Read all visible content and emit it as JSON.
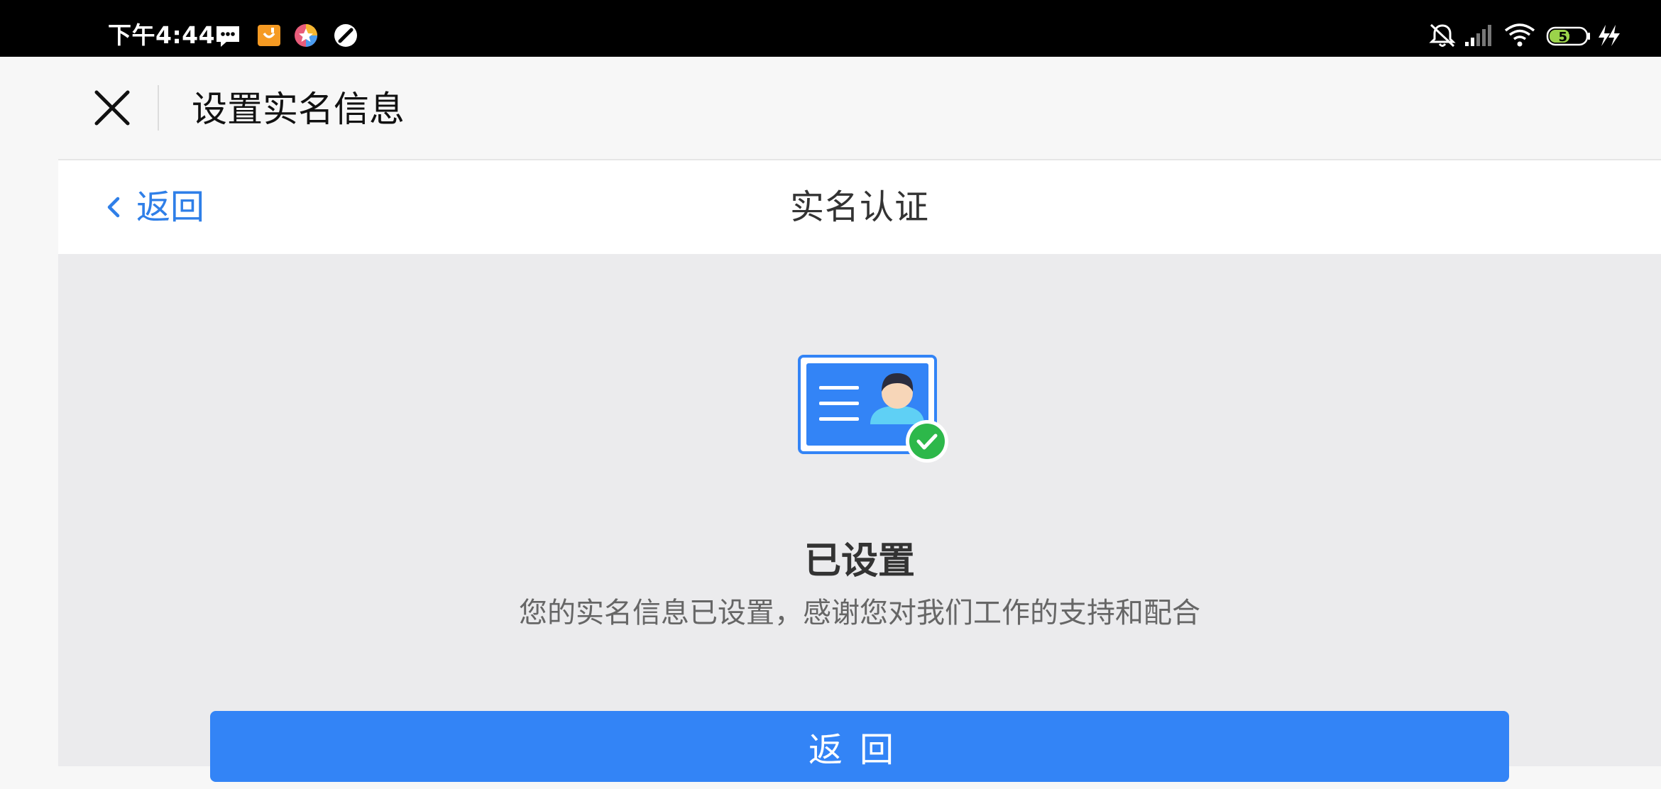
{
  "status_bar": {
    "time": "下午4:44",
    "battery": "51",
    "left_icons": [
      "message-icon",
      "taobao-app-icon",
      "star-app-icon",
      "compass-icon"
    ],
    "right_icons": [
      "mute-bell-icon",
      "signal-icon",
      "wifi-icon",
      "battery-icon",
      "charging-icon"
    ]
  },
  "header": {
    "title": "设置实名信息"
  },
  "nav": {
    "back_label": "返回",
    "title": "实名认证"
  },
  "main": {
    "status_title": "已设置",
    "status_desc": "您的实名信息已设置，感谢您对我们工作的支持和配合",
    "button_label": "返回"
  },
  "colors": {
    "accent": "#3384f6",
    "link": "#2f7fe8",
    "success": "#2db84a"
  }
}
